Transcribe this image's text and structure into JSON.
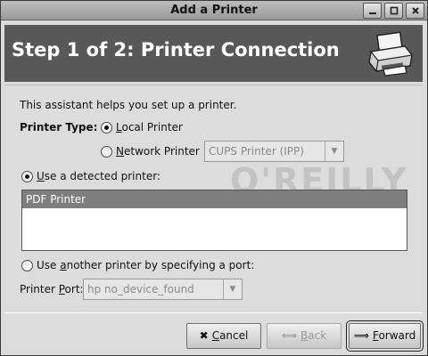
{
  "window": {
    "title": "Add a Printer"
  },
  "header": {
    "title": "Step 1 of 2: Printer Connection"
  },
  "intro": "This assistant helps you set up a printer.",
  "printer_type": {
    "label": "Printer Type:",
    "local": {
      "label_key": "L",
      "label_rest": "ocal Printer",
      "selected": true
    },
    "network": {
      "label_key": "N",
      "label_rest": "etwork Printer",
      "selected": false
    },
    "network_combo": {
      "value": "CUPS Printer (IPP)"
    }
  },
  "detected": {
    "label_key": "U",
    "label_rest": "se a detected printer:",
    "selected": true,
    "printers": [
      "PDF Printer"
    ]
  },
  "port_option": {
    "label_pre": "Use ",
    "label_key": "a",
    "label_rest": "nother printer by specifying a port:",
    "selected": false
  },
  "port": {
    "label_pre": "Printer ",
    "label_key": "P",
    "label_rest": "ort:",
    "value": "hp no_device_found"
  },
  "watermark": "O'REILLY",
  "buttons": {
    "cancel": {
      "key": "C",
      "rest": "ancel",
      "icon": "cancel-x-icon"
    },
    "back": {
      "key": "B",
      "rest": "ack",
      "icon": "back-arrow-icon"
    },
    "forward": {
      "key": "F",
      "rest": "orward",
      "icon": "forward-arrow-icon"
    }
  }
}
